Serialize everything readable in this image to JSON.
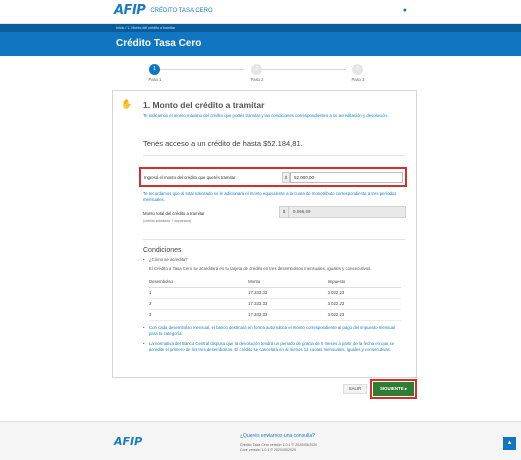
{
  "header": {
    "logo": "AFIP",
    "app_title": "CRÉDITO TASA CERO",
    "user_icon": "user-icon"
  },
  "breadcrumb": "Inicio  /  1. Monto del crédito a tramitar",
  "page_title": "Crédito Tasa Cero",
  "steps": [
    {
      "number": "1",
      "label": "Paso 1",
      "active": true
    },
    {
      "number": "2",
      "label": "Paso 2",
      "active": false
    },
    {
      "number": "3",
      "label": "Paso 3",
      "active": false
    }
  ],
  "section": {
    "icon": "handshake-icon",
    "title": "1. Monto del crédito a tramitar",
    "description": "Te indicamos el monto máximo del crédito que podés tramitar y las condiciones correspondientes a su acreditación y devolución.",
    "access": "Tenés acceso a un crédito de hasta $52.184,81."
  },
  "form": {
    "amount_label": "Ingresá el monto del crédito que querés tramitar",
    "amount_prefix": "$",
    "amount_value": "52.000,00",
    "note": "Te recordamos que al total solicitado se le adicionará el monto equivalente a la cuota de monotributo correspondiente a tres períodos mensuales.",
    "total_label": "Monto total del crédito a tramitar",
    "total_sub": "(crédito solicitado + impuestos)",
    "total_prefix": "$",
    "total_value": "9.066,69"
  },
  "conditions": {
    "title": "Condiciones",
    "q1": "¿Cómo se acredita?",
    "a1": "El Crédito a Tasa Cero se acreditará en tu tarjeta de crédito en tres desembolsos mensuales, iguales y consecutivos.",
    "table_headers": [
      "Desembolso",
      "Monto",
      "Impuesto"
    ],
    "rows": [
      [
        "1",
        "17.333,33",
        "3.022,23"
      ],
      [
        "2",
        "17.333,33",
        "3.022,23"
      ],
      [
        "3",
        "17.333,33",
        "3.022,23"
      ]
    ],
    "b2": "Con cada desembolso mensual, el banco destinará en forma automática el monto correspondiente al pago del impuesto mensual para tu categoría.",
    "b3": "La normativa del Banco Central dispuso que la devolución tendrá un período de gracia de 6 meses a partir de la fecha en que se acredite el primero de los tres desembolsos. El crédito se cancelará en al menos 12 cuotas mensuales, iguales y consecutivas."
  },
  "buttons": {
    "salir": "SALIR",
    "siguiente": "SIGUIENTE ▸"
  },
  "footer": {
    "logo": "AFIP",
    "question": "¿Querés enviarnos una consulta?",
    "version1": "Crédito Tasa Cero versión 1.0.1 © 2020/05/2020",
    "version2": "Core versión 1.0.1 © 2020/05/2020",
    "scroll_top_icon": "chevron-up-icon"
  }
}
